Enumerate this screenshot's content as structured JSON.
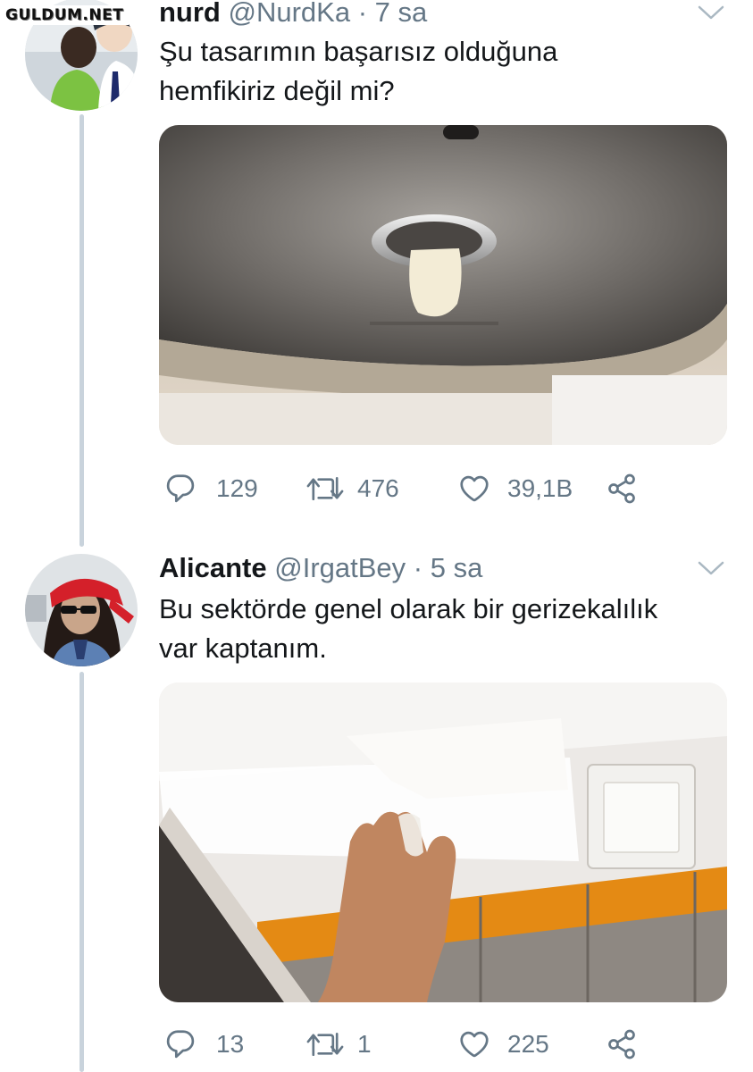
{
  "watermark": "GULDUM.NET",
  "tweets": [
    {
      "name": "nurd",
      "handle": "@NurdKa",
      "time": "7 sa",
      "text_line1": "Şu tasarımın başarısız olduğuna",
      "text_line2": "hemfikiriz değil mi?",
      "replies": "129",
      "retweets": "476",
      "likes": "39,1B"
    },
    {
      "name": "Alicante",
      "handle": "@IrgatBey",
      "time": "5 sa",
      "text_line1": "Bu sektörde genel olarak bir gerizekalılık",
      "text_line2": "var kaptanım.",
      "replies": "13",
      "retweets": "1",
      "likes": "225"
    }
  ],
  "icons": {
    "reply": "reply-icon",
    "retweet": "retweet-icon",
    "like": "heart-icon",
    "share": "share-icon",
    "menu": "chevron-down-icon"
  },
  "colors": {
    "meta": "#657786",
    "text": "#14171a",
    "thread_line": "#c9d3dc"
  }
}
